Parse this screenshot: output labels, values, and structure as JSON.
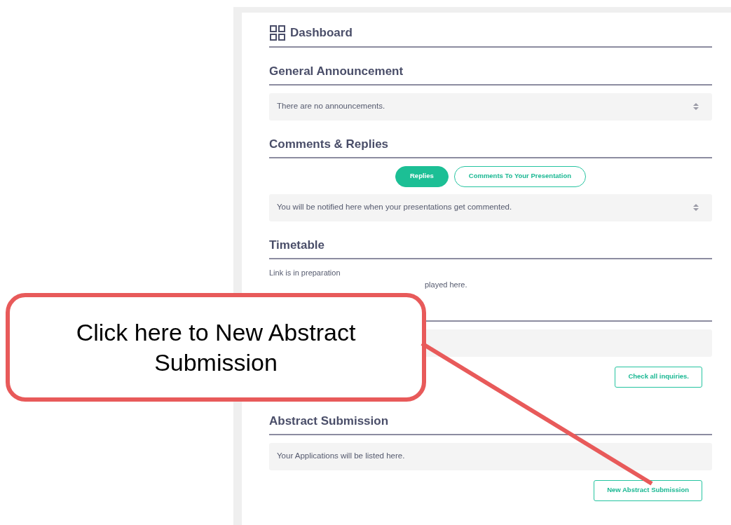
{
  "dashboard": {
    "title": "Dashboard"
  },
  "general_announcement": {
    "heading": "General Announcement",
    "message": "There are no announcements."
  },
  "comments_replies": {
    "heading": "Comments & Replies",
    "tabs": [
      {
        "label": "Replies",
        "selected": true
      },
      {
        "label": "Comments To Your Presentation",
        "selected": false
      }
    ],
    "message": "You will be notified here when your presentations get commented."
  },
  "timetable": {
    "heading": "Timetable",
    "lines": [
      "Link is in preparation",
      "played here."
    ]
  },
  "inquiries": {
    "button": "Check all inquiries."
  },
  "abstract_submission": {
    "heading": "Abstract Submission",
    "message": "Your Applications will be listed here.",
    "button": "New Abstract Submission"
  },
  "callout": {
    "text": "Click here to New Abstract Submission"
  }
}
